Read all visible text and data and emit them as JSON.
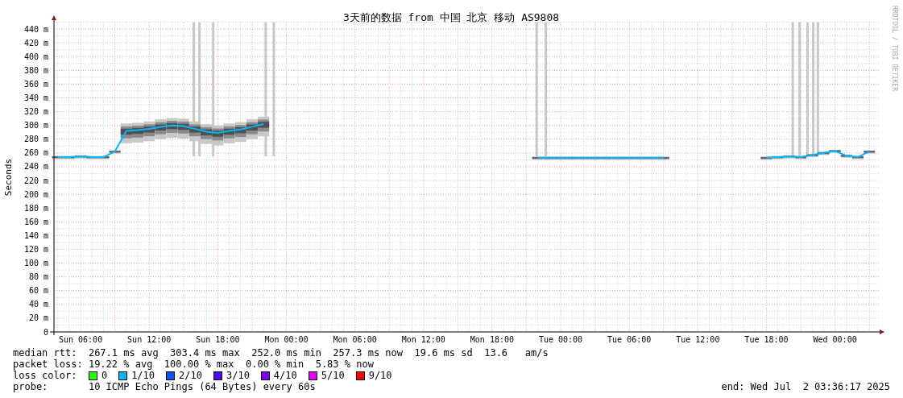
{
  "graph": {
    "chart_data": {
      "type": "line",
      "title": "3天前的数据 from 中国 北京 移动 AS9808",
      "ylabel": "Seconds",
      "categories": [
        null,
        null,
        "Sun 06:00",
        null,
        null,
        null,
        null,
        null,
        "Sun 12:00",
        null,
        null,
        null,
        null,
        null,
        "Sun 18:00",
        null,
        null,
        null,
        null,
        null,
        "Mon 00:00",
        null,
        null,
        null,
        null,
        null,
        "Mon 06:00",
        null,
        null,
        null,
        null,
        null,
        "Mon 12:00",
        null,
        null,
        null,
        null,
        null,
        "Mon 18:00",
        null,
        null,
        null,
        null,
        null,
        "Tue 00:00",
        null,
        null,
        null,
        null,
        null,
        "Tue 06:00",
        null,
        null,
        null,
        null,
        null,
        "Tue 12:00",
        null,
        null,
        null,
        null,
        null,
        "Tue 18:00",
        null,
        null,
        null,
        null,
        null,
        "Wed 00:00",
        null,
        null,
        null
      ],
      "series": [
        {
          "color": "#00b8ff",
          "values": [
            254,
            254,
            255,
            254,
            254,
            262,
            292,
            293,
            295,
            298,
            300,
            299,
            295,
            291,
            289,
            292,
            294,
            298,
            302,
            null,
            null,
            null,
            null,
            null,
            null,
            null,
            null,
            null,
            null,
            null,
            null,
            null,
            null,
            null,
            null,
            null,
            null,
            null,
            null,
            null,
            null,
            null,
            253,
            253,
            253,
            253,
            253,
            253,
            253,
            253,
            253,
            253,
            253,
            253,
            null,
            null,
            null,
            null,
            null,
            null,
            null,
            null,
            253,
            254,
            255,
            254,
            257,
            260,
            263,
            256,
            254,
            262
          ]
        }
      ],
      "ylim": [
        0,
        450
      ],
      "grid": true,
      "yticks": [
        {
          "value": 0,
          "label": "0"
        },
        {
          "value": 20,
          "label": "20 m"
        },
        {
          "value": 40,
          "label": "40 m"
        },
        {
          "value": 60,
          "label": "60 m"
        },
        {
          "value": 80,
          "label": "80 m"
        },
        {
          "value": 100,
          "label": "100 m"
        },
        {
          "value": 120,
          "label": "120 m"
        },
        {
          "value": 140,
          "label": "140 m"
        },
        {
          "value": 160,
          "label": "160 m"
        },
        {
          "value": 180,
          "label": "180 m"
        },
        {
          "value": 200,
          "label": "200 m"
        },
        {
          "value": 220,
          "label": "220 m"
        },
        {
          "value": 240,
          "label": "240 m"
        },
        {
          "value": 260,
          "label": "260 m"
        },
        {
          "value": 280,
          "label": "280 m"
        },
        {
          "value": 300,
          "label": "300 m"
        },
        {
          "value": 320,
          "label": "320 m"
        },
        {
          "value": 340,
          "label": "340 m"
        },
        {
          "value": 360,
          "label": "360 m"
        },
        {
          "value": 380,
          "label": "380 m"
        },
        {
          "value": 400,
          "label": "400 m"
        },
        {
          "value": 420,
          "label": "420 m"
        },
        {
          "value": 440,
          "label": "440 m"
        }
      ]
    },
    "credit": "RRDTOOL / TOBI OETIKER"
  },
  "legend": {
    "rows": [
      {
        "label": "median rtt:",
        "text": "267.1 ms avg  303.4 ms max  252.0 ms min  257.3 ms now  19.6 ms sd  13.6   am/s"
      },
      {
        "label": "packet loss:",
        "text": "19.22 % avg  100.00 % max  0.00 % min  5.83 % now"
      }
    ],
    "loss_color": {
      "label": "loss color:",
      "items": [
        {
          "label": "0",
          "color": "#26ff00"
        },
        {
          "label": "1/10",
          "color": "#00b8ff"
        },
        {
          "label": "2/10",
          "color": "#0059ff"
        },
        {
          "label": "3/10",
          "color": "#5e00ff"
        },
        {
          "label": "4/10",
          "color": "#7e00ff"
        },
        {
          "label": "5/10",
          "color": "#dd00ff"
        },
        {
          "label": "9/10",
          "color": "#ff0000"
        }
      ]
    },
    "probe": {
      "label": "probe:",
      "text": "10 ICMP Echo Pings (64 Bytes) every 60s"
    },
    "end": "end: Wed Jul  2 03:36:17 2025"
  }
}
